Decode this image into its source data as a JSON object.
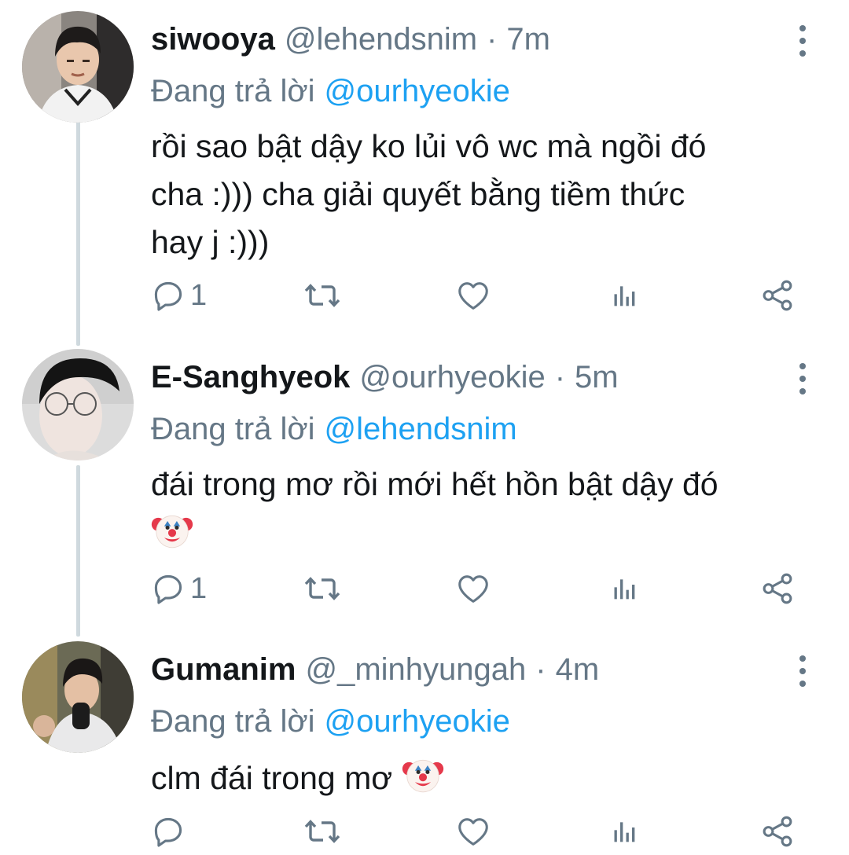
{
  "tweets": [
    {
      "name": "siwooya",
      "handle": "@lehendsnim",
      "separator": "·",
      "time": "7m",
      "replying_prefix": "Đang trả lời",
      "replying_to": "@ourhyeokie",
      "lines": [
        "rồi sao bật dậy ko lủi vô wc mà ngồi đó",
        "cha :))) cha giải quyết bằng tiềm thức",
        "hay j :)))"
      ],
      "reply_count": "1"
    },
    {
      "name": "E-Sanghyeok",
      "handle": "@ourhyeokie",
      "separator": "·",
      "time": "5m",
      "replying_prefix": "Đang trả lời",
      "replying_to": "@lehendsnim",
      "lines": [
        "đái trong mơ rồi mới hết hồn bật dậy đó"
      ],
      "emoji": "clown-face",
      "reply_count": "1"
    },
    {
      "name": "Gumanim",
      "handle": "@_minhyungah",
      "separator": "·",
      "time": "4m",
      "replying_prefix": "Đang trả lời",
      "replying_to": "@ourhyeokie",
      "lines": [
        "clm đái trong mơ"
      ],
      "emoji": "clown-face",
      "reply_count": ""
    }
  ],
  "icons": [
    "reply-icon",
    "retweet-icon",
    "like-icon",
    "analytics-icon",
    "share-icon",
    "more-icon"
  ],
  "colors": {
    "text": "#14171a",
    "secondary": "#657786",
    "accent": "#1da1f2",
    "thread": "#cfd9de"
  }
}
